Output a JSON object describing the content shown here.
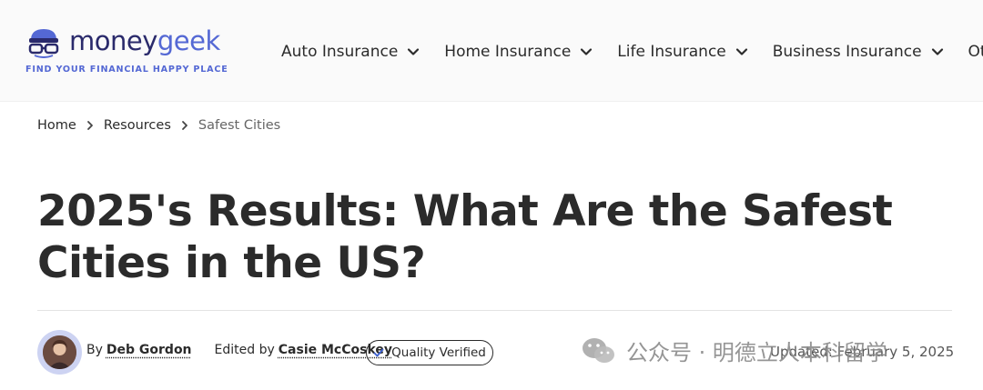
{
  "logo": {
    "word_part1": "money",
    "word_part2": "geek",
    "tagline": "FIND YOUR FINANCIAL HAPPY PLACE",
    "colors": {
      "dark": "#2a2a6b",
      "accent": "#5468d4"
    }
  },
  "nav": {
    "items": [
      {
        "label": "Auto Insurance",
        "icon": "chevron-down-icon"
      },
      {
        "label": "Home Insurance",
        "icon": "chevron-down-icon"
      },
      {
        "label": "Life Insurance",
        "icon": "chevron-down-icon"
      },
      {
        "label": "Business Insurance",
        "icon": "chevron-down-icon"
      },
      {
        "label": "Other I",
        "icon": "chevron-down-icon"
      }
    ]
  },
  "breadcrumb": {
    "items": [
      "Home",
      "Resources",
      "Safest Cities"
    ],
    "separator_icon": "chevron-right-icon"
  },
  "article": {
    "title": "2025's Results: What Are the Safest Cities in the US?",
    "by_prefix": "By",
    "author": "Deb Gordon",
    "edited_prefix": "Edited by",
    "editor": "Casie McCoskey",
    "badge": {
      "label": "Quality Verified",
      "icon": "check-icon"
    },
    "updated": "Updated: February 5, 2025"
  },
  "watermark": {
    "icon": "wechat-icon",
    "text": "公众号 · 明德立人本科留学"
  }
}
